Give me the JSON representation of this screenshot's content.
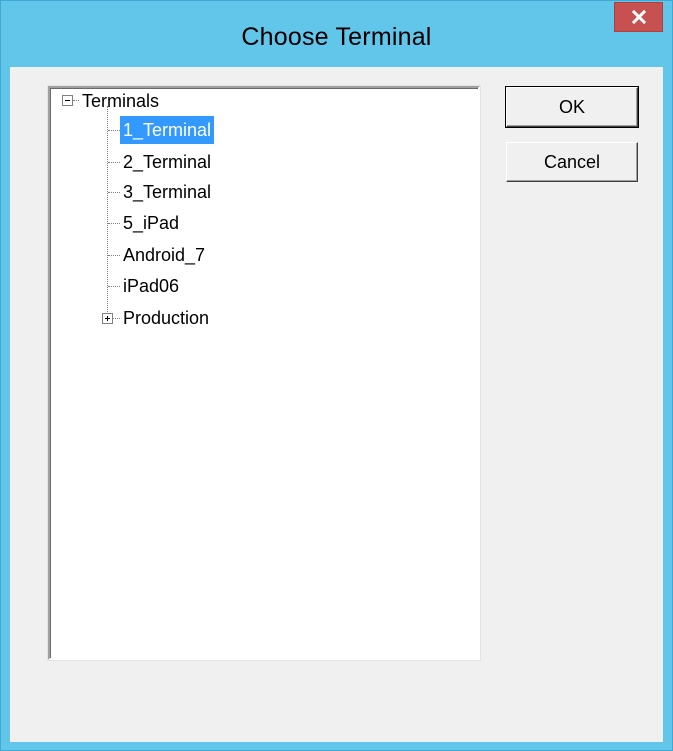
{
  "window": {
    "title": "Choose Terminal",
    "close_glyph": "x",
    "title_color": "#62c5ea",
    "close_color": "#c75050"
  },
  "tree": {
    "root": {
      "label": "Terminals",
      "expanded": true,
      "children": [
        {
          "label": "1_Terminal",
          "selected": true
        },
        {
          "label": "2_Terminal"
        },
        {
          "label": "3_Terminal"
        },
        {
          "label": "5_iPad"
        },
        {
          "label": "Android_7"
        },
        {
          "label": "iPad06"
        },
        {
          "label": "Production",
          "expandable": true,
          "expanded": false
        }
      ]
    },
    "selection_color": "#3399ff"
  },
  "buttons": {
    "ok_label": "OK",
    "cancel_label": "Cancel"
  }
}
